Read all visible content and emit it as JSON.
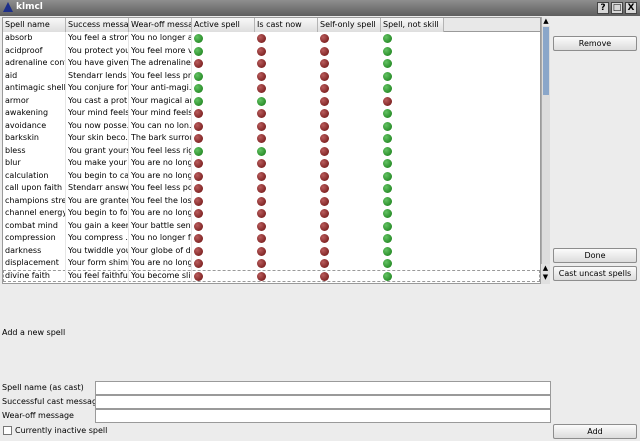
{
  "window": {
    "title": "klmcl",
    "help_label": "?",
    "max_label": "□",
    "close_label": "X"
  },
  "table": {
    "columns": [
      "Spell name",
      "Success message",
      "Wear-off message",
      "Active spell",
      "Is cast now",
      "Self-only spell",
      "Spell, not skill"
    ],
    "rows": [
      {
        "name": "absorb",
        "success": "You feel a stron...",
        "wearoff": "You no longer a...",
        "active": "green",
        "cast": "red",
        "self": "red",
        "spell": "green"
      },
      {
        "name": "acidproof",
        "success": "You protect you...",
        "wearoff": "You feel more v...",
        "active": "green",
        "cast": "red",
        "self": "red",
        "spell": "green"
      },
      {
        "name": "adrenaline cont...",
        "success": "You have given ...",
        "wearoff": "The adrenaline r...",
        "active": "red",
        "cast": "red",
        "self": "red",
        "spell": "green"
      },
      {
        "name": "aid",
        "success": "Stendarr lends ...",
        "wearoff": "You feel less pr...",
        "active": "green",
        "cast": "red",
        "self": "red",
        "spell": "green"
      },
      {
        "name": "antimagic shell",
        "success": "You conjure fort...",
        "wearoff": "Your anti-magi...",
        "active": "green",
        "cast": "red",
        "self": "red",
        "spell": "green"
      },
      {
        "name": "armor",
        "success": "You cast a prot...",
        "wearoff": "Your magical ar...",
        "active": "green",
        "cast": "green",
        "self": "red",
        "spell": "red"
      },
      {
        "name": "awakening",
        "success": "Your mind feels...",
        "wearoff": "Your mind feels...",
        "active": "red",
        "cast": "red",
        "self": "red",
        "spell": "green"
      },
      {
        "name": "avoidance",
        "success": "You now posse...",
        "wearoff": "You can no lon...",
        "active": "red",
        "cast": "red",
        "self": "red",
        "spell": "green"
      },
      {
        "name": "barkskin",
        "success": "Your skin beco...",
        "wearoff": "The bark surrou...",
        "active": "red",
        "cast": "red",
        "self": "red",
        "spell": "green"
      },
      {
        "name": "bless",
        "success": "You grant yours...",
        "wearoff": "You feel less rig...",
        "active": "green",
        "cast": "green",
        "self": "red",
        "spell": "green"
      },
      {
        "name": "blur",
        "success": "You make your ...",
        "wearoff": "You are no long...",
        "active": "red",
        "cast": "red",
        "self": "red",
        "spell": "green"
      },
      {
        "name": "calculation",
        "success": "You begin to ca...",
        "wearoff": "You are no long...",
        "active": "red",
        "cast": "red",
        "self": "red",
        "spell": "green"
      },
      {
        "name": "call upon faith",
        "success": "Stendarr answe...",
        "wearoff": "You feel less po...",
        "active": "red",
        "cast": "red",
        "self": "red",
        "spell": "green"
      },
      {
        "name": "champions stre...",
        "success": "You are granted...",
        "wearoff": "You feel the los...",
        "active": "red",
        "cast": "red",
        "self": "red",
        "spell": "green"
      },
      {
        "name": "channel energy",
        "success": "You begin to fo...",
        "wearoff": "You are no long...",
        "active": "red",
        "cast": "red",
        "self": "red",
        "spell": "green"
      },
      {
        "name": "combat mind",
        "success": "You gain a keen...",
        "wearoff": "Your battle sens...",
        "active": "red",
        "cast": "red",
        "self": "red",
        "spell": "green"
      },
      {
        "name": "compression",
        "success": "You compress ...",
        "wearoff": "You no longer f...",
        "active": "red",
        "cast": "red",
        "self": "red",
        "spell": "green"
      },
      {
        "name": "darkness",
        "success": "You twiddle you...",
        "wearoff": "Your globe of d...",
        "active": "red",
        "cast": "red",
        "self": "red",
        "spell": "green"
      },
      {
        "name": "displacement",
        "success": "Your form shim...",
        "wearoff": "You are no long...",
        "active": "red",
        "cast": "red",
        "self": "red",
        "spell": "green"
      },
      {
        "name": "divine faith",
        "success": "You feel faithful...",
        "wearoff": "You become sli...",
        "active": "red",
        "cast": "red",
        "self": "red",
        "spell": "green"
      }
    ]
  },
  "buttons": {
    "remove": "Remove",
    "done": "Done",
    "cast_uncast": "Cast uncast spells",
    "add": "Add"
  },
  "form": {
    "section_title": "Add a new spell",
    "spell_name_label": "Spell name (as cast)",
    "success_label": "Successful cast message",
    "wearoff_label": "Wear-off message",
    "spell_name_value": "",
    "success_value": "",
    "wearoff_value": "",
    "inactive_label": "Currently inactive spell"
  },
  "icons": {
    "app": "app-triangle-icon"
  },
  "colors": {
    "active_dot": "#1a8a1a",
    "inactive_dot": "#7a1a1a",
    "titlebar": "#6e6e6e"
  }
}
